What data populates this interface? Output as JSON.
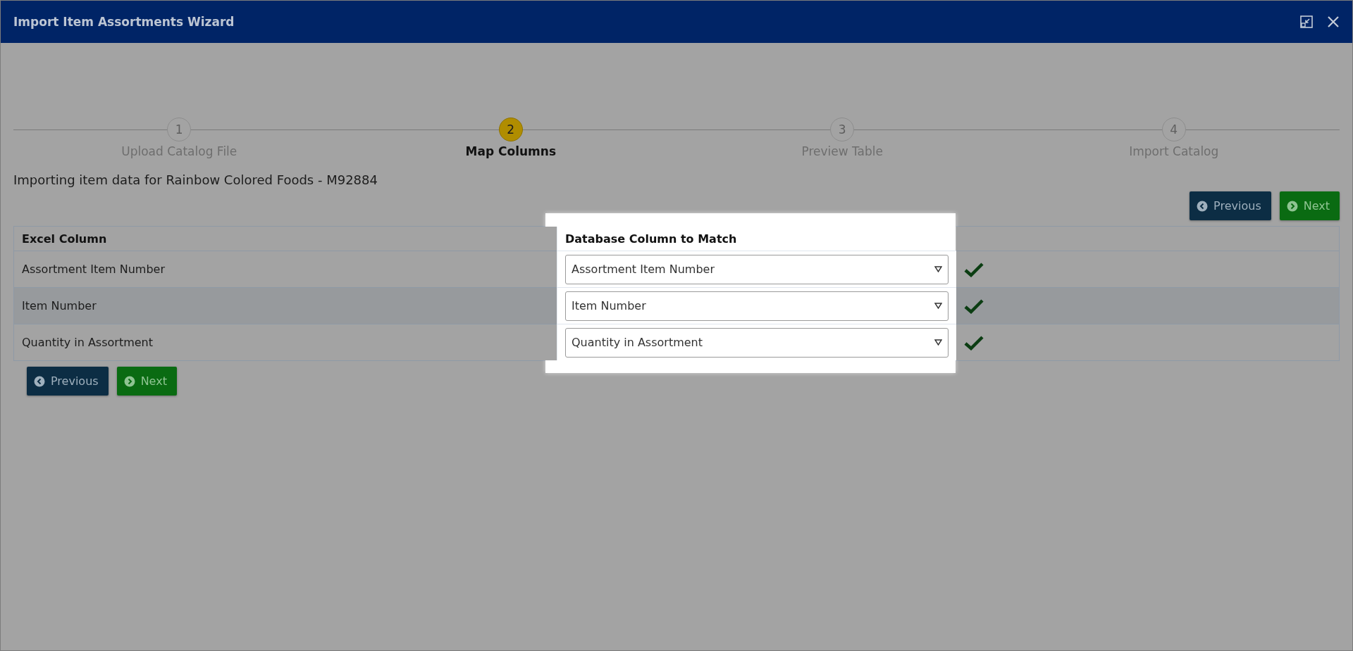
{
  "window": {
    "title": "Import Item Assortments Wizard"
  },
  "steps": [
    {
      "number": "1",
      "label": "Upload Catalog File",
      "selected": false
    },
    {
      "number": "2",
      "label": "Map Columns",
      "selected": true
    },
    {
      "number": "3",
      "label": "Preview Table",
      "selected": false
    },
    {
      "number": "4",
      "label": "Import Catalog",
      "selected": false
    }
  ],
  "intro": "Importing item data for Rainbow Colored Foods - M92884",
  "top_buttons": [
    {
      "kind": "previous",
      "label": "Previous"
    },
    {
      "kind": "next",
      "label": "Next"
    }
  ],
  "table": {
    "columns": [
      "Excel Column",
      "Database Column to Match"
    ],
    "rows": [
      {
        "excel": "Assortment Item Number",
        "match": "Assortment Item Number",
        "matched": true,
        "highlighted": false
      },
      {
        "excel": "Item Number",
        "match": "Item Number",
        "matched": true,
        "highlighted": true
      },
      {
        "excel": "Quantity in Assortment",
        "match": "Quantity in Assortment",
        "matched": true,
        "highlighted": false
      }
    ]
  },
  "bottom_buttons": [
    {
      "kind": "previous",
      "label": "Previous"
    },
    {
      "kind": "next",
      "label": "Next"
    }
  ]
}
